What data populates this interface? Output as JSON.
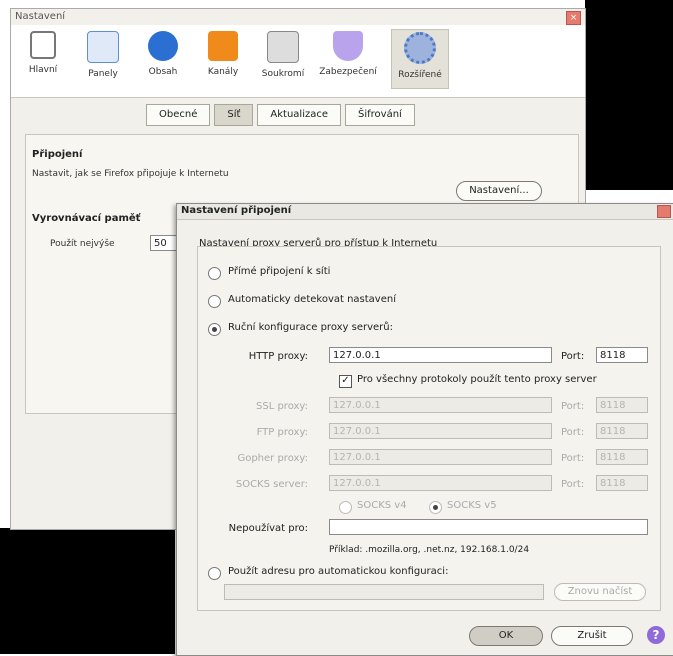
{
  "main_window": {
    "title": "Nastavení",
    "toolbar": [
      {
        "label": "Hlavní",
        "icon": "device-icon",
        "color": "#777"
      },
      {
        "label": "Panely",
        "icon": "tabs-icon",
        "color": "#5b8fd6"
      },
      {
        "label": "Obsah",
        "icon": "globe-icon",
        "color": "#2a6fd1"
      },
      {
        "label": "Kanály",
        "icon": "rss-icon",
        "color": "#f08a1a"
      },
      {
        "label": "Soukromí",
        "icon": "privacy-icon",
        "color": "#888"
      },
      {
        "label": "Zabezpečení",
        "icon": "shield-icon",
        "color": "#6b45c9"
      },
      {
        "label": "Rozšířené",
        "icon": "gear-icon",
        "color": "#4d79c4",
        "selected": true
      }
    ],
    "tabs": [
      "Obecné",
      "Síť",
      "Aktualizace",
      "Šifrování"
    ],
    "selected_tab": "Síť",
    "connection_heading": "Připojení",
    "connection_desc": "Nastavit, jak se Firefox připojuje k Internetu",
    "settings_button": "Nastavení...",
    "offline_heading": "Vyrovnávací paměť",
    "use_up_to": "Použít nejvýše",
    "use_value": "50"
  },
  "dialog": {
    "title": "Nastavení připojení",
    "group_label": "Nastavení proxy serverů pro přístup k Internetu",
    "options": {
      "no_proxy": "Přímé připojení k síti",
      "auto_detect": "Automaticky detekovat nastavení",
      "manual": "Ruční konfigurace proxy serverů:",
      "auto_url": "Použít adresu pro automatickou konfiguraci:"
    },
    "selected_option": "manual",
    "http_label": "HTTP proxy:",
    "http_value": "127.0.0.1",
    "port_label": "Port:",
    "http_port": "8118",
    "same_proxy": "Pro všechny protokoly použít tento proxy server",
    "ssl_label": "SSL proxy:",
    "ftp_label": "FTP proxy:",
    "gopher_label": "Gopher proxy:",
    "socks_label": "SOCKS server:",
    "ssl_value": "127.0.0.1",
    "ftp_value": "127.0.0.1",
    "gopher_value": "127.0.0.1",
    "socks_value": "127.0.0.1",
    "ssl_port": "8118",
    "ftp_port": "8118",
    "gopher_port": "8118",
    "socks_port": "8118",
    "socks_v4": "SOCKS v4",
    "socks_v5": "SOCKS v5",
    "no_proxy_for": "Nepoužívat pro:",
    "no_proxy_value": "",
    "example": "Příklad: .mozilla.org, .net.nz, 192.168.1.0/24",
    "reload_button": "Znovu načíst",
    "ok_button": "OK",
    "cancel_button": "Zrušit",
    "help_button": "?"
  }
}
